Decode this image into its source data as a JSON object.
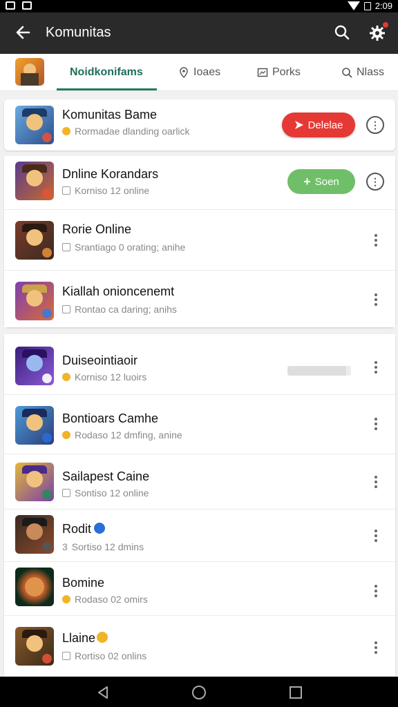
{
  "status_bar": {
    "time": "2:09"
  },
  "app_bar": {
    "title": "Komunitas"
  },
  "tabs": [
    {
      "label": "Noidkonifams",
      "icon": "app-thumbnail",
      "active": true
    },
    {
      "label": "Ioaes",
      "icon": "location-pin-icon",
      "active": false
    },
    {
      "label": "Porks",
      "icon": "image-frame-icon",
      "active": false
    },
    {
      "label": "Nlass",
      "icon": "search-icon",
      "active": false
    }
  ],
  "communities": [
    {
      "name": "Komunitas Bame",
      "status": "Rormadae dlanding oarlick",
      "status_icon": "gold-dot",
      "action": {
        "type": "button-red",
        "label": "Delelae"
      },
      "menu": "info",
      "colors": [
        "#6ca9e0",
        "#2c4f8c"
      ]
    },
    {
      "name": "Dnline Korandars",
      "status": "Korniso 12 online",
      "status_icon": "check",
      "action": {
        "type": "button-green",
        "label": "Soen"
      },
      "menu": "info",
      "colors": [
        "#5a3b8f",
        "#c76a2e"
      ]
    },
    {
      "name": "Rorie Online",
      "status": "Srantiago 0 orating; anihe",
      "status_icon": "check",
      "menu": "more",
      "colors": [
        "#7a3b2a",
        "#3b2a20"
      ]
    },
    {
      "name": "Kiallah onioncenemt",
      "status": "Rontao ca daring; anihs",
      "status_icon": "check",
      "menu": "more",
      "colors": [
        "#7d3fb0",
        "#d96b3a"
      ]
    },
    {
      "name": "Duiseointiaoir",
      "status": "Korniso 12 luoirs",
      "status_icon": "gold-dot",
      "action": {
        "type": "progress",
        "value": 0.92
      },
      "menu": "more",
      "colors": [
        "#3a1f7a",
        "#8a5ad8"
      ]
    },
    {
      "name": "Bontioars Camhe",
      "status": "Rodaso 12 dmfing, anine",
      "status_icon": "gold-dot",
      "menu": "more",
      "colors": [
        "#4e9ad8",
        "#2a3f7a"
      ]
    },
    {
      "name": "Sailapest Caine",
      "status": "Sontiso 12 online",
      "status_icon": "check",
      "menu": "more",
      "colors": [
        "#e0b83a",
        "#7a3fa8"
      ]
    },
    {
      "name": "Rodit",
      "name_badge": "verified",
      "status": "Sortiso 12 dmins",
      "status_prefix": "3",
      "menu": "more",
      "colors": [
        "#3a2a24",
        "#8a4a2a"
      ]
    },
    {
      "name": "Bomine",
      "status": "Rodaso 02 omirs",
      "status_icon": "gold-dot",
      "menu": "more",
      "colors": [
        "#0d2a1a",
        "#b85a2a"
      ]
    },
    {
      "name": "Llaine",
      "name_badge": "gold",
      "status": "Rortiso 02 onlins",
      "status_icon": "check",
      "menu": "more",
      "colors": [
        "#8a5a2a",
        "#3a2a1a"
      ]
    }
  ]
}
